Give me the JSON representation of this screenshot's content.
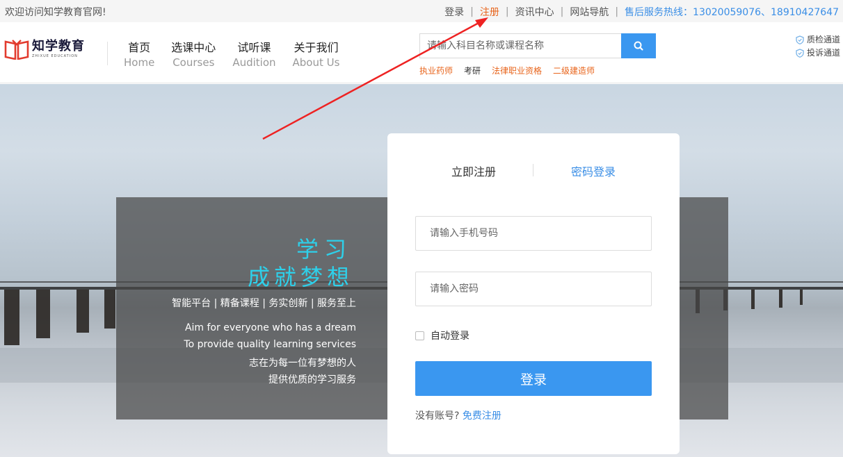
{
  "topbar": {
    "welcome": "欢迎访问知学教育官网!",
    "links": {
      "login": "登录",
      "register": "注册",
      "news": "资讯中心",
      "sitemap": "网站导航",
      "hotline": "售后服务热线：13020059076、18910427647"
    },
    "separator": "|"
  },
  "header": {
    "logo": {
      "name": "知学教育",
      "tagline": "ZHIXUE EDUCATION"
    },
    "nav": [
      {
        "cn": "首页",
        "en": "Home"
      },
      {
        "cn": "选课中心",
        "en": "Courses"
      },
      {
        "cn": "试听课",
        "en": "Audition"
      },
      {
        "cn": "关于我们",
        "en": "About Us"
      }
    ],
    "search": {
      "placeholder": "请输入科目名称或课程名称"
    },
    "hotwords": [
      "执业药师",
      "考研",
      "法律职业资格",
      "二级建造师"
    ],
    "channels": [
      "质检通道",
      "投诉通道"
    ]
  },
  "banner": {
    "slogan": {
      "line1": "学习",
      "line2": "成就梦想",
      "features": "智能平台 | 精备课程 | 务实创新 | 服务至上",
      "en1": "Aim for everyone who has a dream",
      "en2": "To provide quality learning services",
      "cn1": "志在为每一位有梦想的人",
      "cn2": "提供优质的学习服务"
    }
  },
  "login_card": {
    "tab_register": "立即注册",
    "tab_login": "密码登录",
    "phone_placeholder": "请输入手机号码",
    "password_placeholder": "请输入密码",
    "remember_label": "自动登录",
    "submit_label": "登录",
    "no_account": "没有账号?",
    "free_register": "免费注册"
  },
  "colors": {
    "accent": "#3a97f0",
    "orange": "#e8641b",
    "slogan_cyan": "#2ed0ea",
    "arrow": "#ee2222"
  }
}
